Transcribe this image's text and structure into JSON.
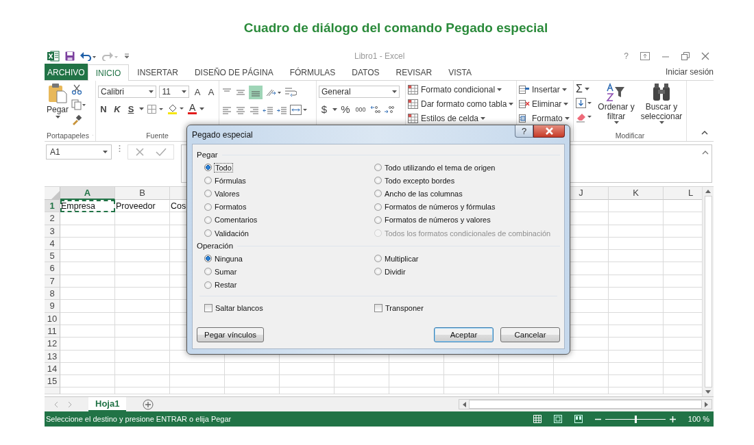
{
  "caption": "Cuadro de diálogo del comando Pegado especial",
  "window": {
    "title": "Libro1 - Excel",
    "help": "?",
    "account": "Iniciar sesión"
  },
  "tabs": [
    {
      "label": "ARCHIVO",
      "kind": "file",
      "selected": false
    },
    {
      "label": "INICIO",
      "kind": "tab",
      "selected": true
    },
    {
      "label": "INSERTAR",
      "kind": "tab",
      "selected": false
    },
    {
      "label": "DISEÑO DE PÁGINA",
      "kind": "tab",
      "selected": false
    },
    {
      "label": "FÓRMULAS",
      "kind": "tab",
      "selected": false
    },
    {
      "label": "DATOS",
      "kind": "tab",
      "selected": false
    },
    {
      "label": "REVISAR",
      "kind": "tab",
      "selected": false
    },
    {
      "label": "VISTA",
      "kind": "tab",
      "selected": false
    }
  ],
  "ribbon": {
    "clipboard": {
      "paste": "Pegar",
      "label": "Portapapeles"
    },
    "font": {
      "name": "Calibri",
      "size": "11",
      "grow": "A",
      "shrink": "A",
      "bold": "N",
      "italic": "K",
      "underline": "S",
      "font_letter": "A",
      "label": "Fuente"
    },
    "number": {
      "format": "General",
      "currency": "$",
      "percent": "%",
      "thousands": "000"
    },
    "styles": [
      "Formato condicional",
      "Dar formato como tabla",
      "Estilos de celda"
    ],
    "cells": [
      "Insertar",
      "Eliminar",
      "Formato"
    ],
    "editing": {
      "autosum": "Σ",
      "sort": "Ordenar y filtrar",
      "find": "Buscar y seleccionar",
      "label": "Modificar"
    }
  },
  "formula_bar": {
    "name_box": "A1"
  },
  "grid": {
    "columns_left": [
      {
        "label": "A",
        "selected": true
      },
      {
        "label": "B",
        "selected": false
      }
    ],
    "columns_right": [
      {
        "label": "J",
        "selected": false
      },
      {
        "label": "K",
        "selected": false
      },
      {
        "label": "L",
        "selected": false
      }
    ],
    "rows": [
      {
        "label": "1",
        "selected": true,
        "cells": [
          {
            "text": "Empresa",
            "selected": true
          },
          {
            "text": "Proveedor",
            "selected": false
          },
          {
            "text": "Cos",
            "selected": false
          }
        ]
      },
      {
        "label": "2",
        "selected": false
      },
      {
        "label": "3",
        "selected": false
      },
      {
        "label": "4",
        "selected": false
      },
      {
        "label": "5",
        "selected": false
      },
      {
        "label": "6",
        "selected": false
      },
      {
        "label": "7",
        "selected": false
      },
      {
        "label": "8",
        "selected": false
      },
      {
        "label": "9",
        "selected": false
      },
      {
        "label": "10",
        "selected": false
      },
      {
        "label": "11",
        "selected": false
      },
      {
        "label": "12",
        "selected": false
      },
      {
        "label": "13",
        "selected": false
      },
      {
        "label": "14",
        "selected": false
      },
      {
        "label": "15",
        "selected": false
      }
    ]
  },
  "sheets": [
    {
      "label": "Hoja1",
      "selected": true
    }
  ],
  "status_bar": {
    "message": "Seleccione el destino y presione ENTRAR o elija Pegar",
    "zoom_slider": {
      "level": 0.5
    },
    "zoom": "100 %"
  },
  "dialog": {
    "title": "Pegado especial",
    "help": "?",
    "paste_label": "Pegar",
    "paste_options": [
      {
        "label": "Todo",
        "selected": true,
        "disabled": false
      },
      {
        "label": "Fórmulas",
        "selected": false,
        "disabled": false
      },
      {
        "label": "Valores",
        "selected": false,
        "disabled": false
      },
      {
        "label": "Formatos",
        "selected": false,
        "disabled": false
      },
      {
        "label": "Comentarios",
        "selected": false,
        "disabled": false
      },
      {
        "label": "Validación",
        "selected": false,
        "disabled": false
      },
      {
        "label": "Todo utilizando el tema de origen",
        "selected": false,
        "disabled": false
      },
      {
        "label": "Todo excepto bordes",
        "selected": false,
        "disabled": false
      },
      {
        "label": "Ancho de las columnas",
        "selected": false,
        "disabled": false
      },
      {
        "label": "Formatos de números y fórmulas",
        "selected": false,
        "disabled": false
      },
      {
        "label": "Formatos de números y valores",
        "selected": false,
        "disabled": false
      },
      {
        "label": "Todos los formatos condicionales de combinación",
        "selected": false,
        "disabled": true
      }
    ],
    "operation_label": "Operación",
    "operation_options": [
      {
        "label": "Ninguna",
        "selected": true
      },
      {
        "label": "Sumar",
        "selected": false
      },
      {
        "label": "Restar",
        "selected": false
      },
      {
        "label": "Multiplicar",
        "selected": false
      },
      {
        "label": "Dividir",
        "selected": false
      }
    ],
    "checkboxes": [
      {
        "label": "Saltar blancos",
        "checked": false
      },
      {
        "label": "Transponer",
        "checked": false
      }
    ],
    "buttons": [
      {
        "label": "Pegar vínculos",
        "kind": "link"
      },
      {
        "label": "Aceptar",
        "kind": "default"
      },
      {
        "label": "Cancelar",
        "kind": "normal"
      }
    ]
  }
}
